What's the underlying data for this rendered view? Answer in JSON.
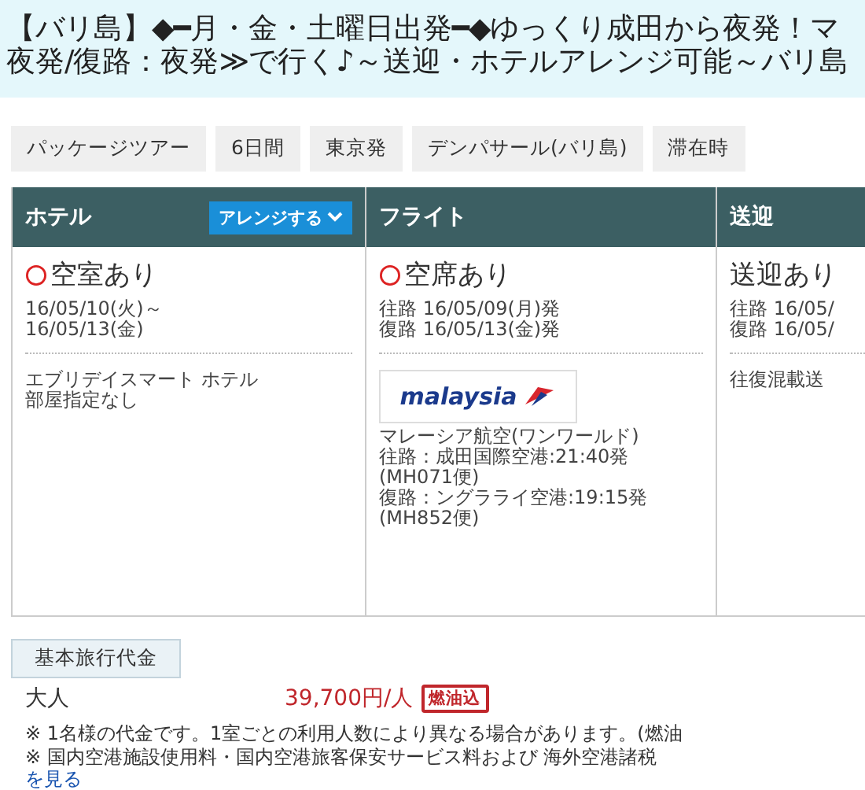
{
  "title": {
    "lines": [
      "【バリ島】◆━月・金・土曜日出発━◆ゆっくり成田から夜発！マ",
      "夜発/復路：夜発≫で行く♪～送迎・ホテルアレンジ可能～バリ島"
    ]
  },
  "tags": [
    "パッケージツアー",
    "6日間",
    "東京発",
    "デンパサール(バリ島)",
    "滞在時"
  ],
  "columns": [
    {
      "kind": "hotel",
      "header": "ホテル",
      "arrange_button": "アレンジする",
      "status": "空室あり",
      "available": true,
      "dates": [
        "16/05/10(火)～",
        "16/05/13(金)"
      ],
      "details": [
        "エブリデイスマート ホテル",
        "部屋指定なし"
      ]
    },
    {
      "kind": "flight",
      "header": "フライト",
      "status": "空席あり",
      "available": true,
      "dates": [
        "往路 16/05/09(月)発",
        "復路 16/05/13(金)発"
      ],
      "airline_logo": "malaysia",
      "details": [
        "マレーシア航空(ワンワールド)",
        "往路：成田国際空港:21:40発",
        "(MH071便)",
        "復路：ングラライ空港:19:15発",
        "(MH852便)"
      ]
    },
    {
      "kind": "transfer",
      "header": "送迎",
      "status": "送迎あり",
      "dates": [
        "往路 16/05/",
        "復路 16/05/"
      ],
      "details": [
        "往復混載送"
      ]
    }
  ],
  "price": {
    "label": "基本旅行代金",
    "rows": [
      {
        "name": "大人",
        "amount": "39,700円/人",
        "badge": "燃油込"
      }
    ],
    "notes": [
      "※ 1名様の代金です。1室ごとの利用人数により異なる場合があります。(燃油",
      "※ 国内空港施設使用料・国内空港旅客保安サービス料および 海外空港諸税"
    ],
    "link": "を見る"
  }
}
